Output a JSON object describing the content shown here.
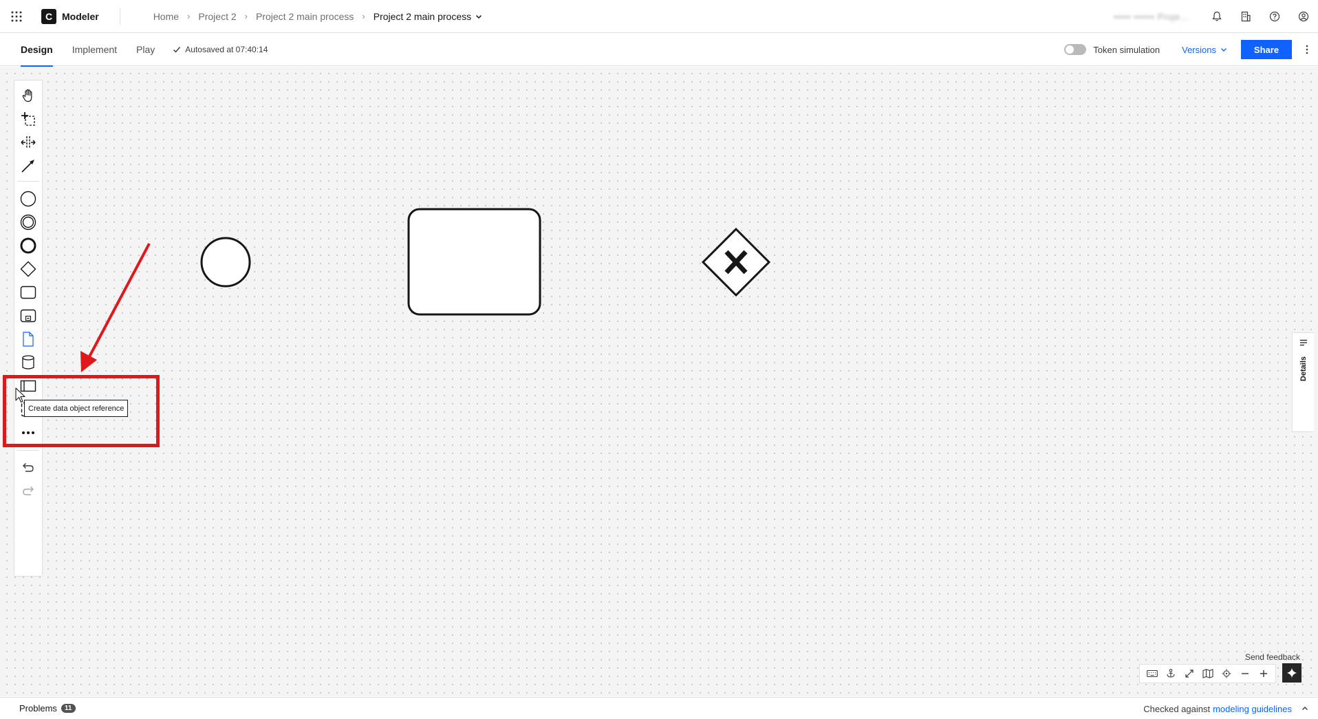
{
  "header": {
    "app_name": "Modeler",
    "logo_letter": "C",
    "breadcrumb": [
      "Home",
      "Project 2",
      "Project 2 main process"
    ],
    "current_file": "Project 2 main process",
    "user_name": "••••• •••••• Proje..."
  },
  "tabs": [
    {
      "label": "Design",
      "active": true
    },
    {
      "label": "Implement",
      "active": false
    },
    {
      "label": "Play",
      "active": false
    }
  ],
  "autosave": "Autosaved at 07:40:14",
  "token_simulation": {
    "label": "Token simulation",
    "enabled": false
  },
  "versions_label": "Versions",
  "share_label": "Share",
  "palette": {
    "tools": [
      "hand-tool",
      "lasso-tool",
      "space-tool",
      "global-connect-tool",
      "create-start-event",
      "create-intermediate-event",
      "create-end-event",
      "create-gateway",
      "create-task",
      "create-subprocess",
      "create-data-object-reference",
      "create-data-store-reference",
      "create-pool",
      "create-group",
      "more-tools",
      "undo",
      "redo"
    ]
  },
  "tooltip": "Create data object reference",
  "details_label": "Details",
  "send_feedback": "Send feedback",
  "status": {
    "problems_label": "Problems",
    "problems_count": "11",
    "checked_prefix": "Checked against",
    "guidelines_link": "modeling guidelines"
  },
  "colors": {
    "accent": "#0f62fe",
    "highlight": "#e0171b",
    "canvas": "#f4f4f4"
  }
}
